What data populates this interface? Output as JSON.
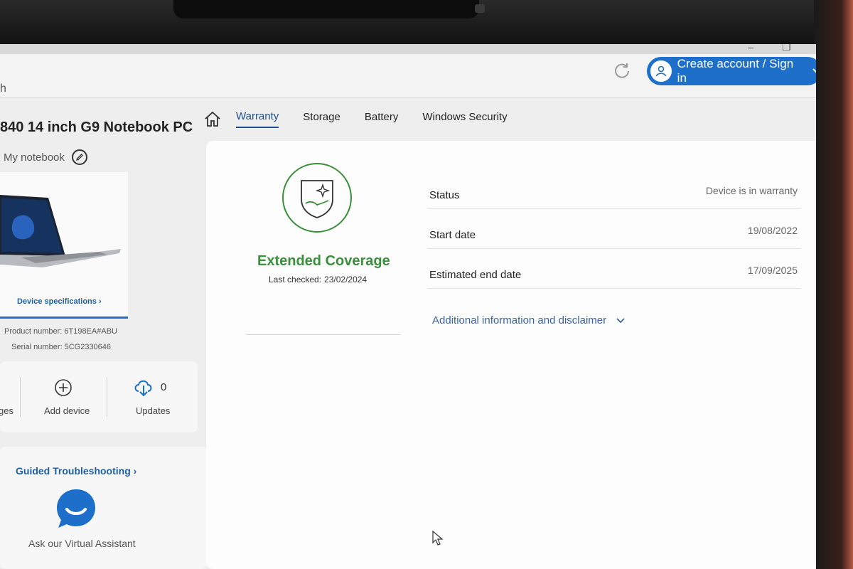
{
  "header": {
    "search_fragment": "h",
    "signin_label": "Create account / Sign in"
  },
  "device": {
    "title": "840 14 inch G9 Notebook PC",
    "nickname": "My notebook",
    "spec_link": "Device specifications ›",
    "product_number": "Product number: 6T198EA#ABU",
    "serial_number": "Serial number: 5CG2330646"
  },
  "actions": {
    "left_partial_label": "ges",
    "add_device_label": "Add device",
    "updates_label": "Updates",
    "updates_count": "0"
  },
  "help": {
    "guided_label": "Guided Troubleshooting ›",
    "assistant_label": "Ask our Virtual Assistant"
  },
  "tabs": [
    {
      "label": "Warranty",
      "active": true
    },
    {
      "label": "Storage",
      "active": false
    },
    {
      "label": "Battery",
      "active": false
    },
    {
      "label": "Windows Security",
      "active": false
    }
  ],
  "warranty": {
    "coverage_title": "Extended Coverage",
    "last_checked_label": "Last checked:",
    "last_checked_date": "23/02/2024",
    "rows": [
      {
        "label": "Status",
        "value": "Device is in warranty"
      },
      {
        "label": "Start date",
        "value": "19/08/2022"
      },
      {
        "label": "Estimated end date",
        "value": "17/09/2025"
      }
    ],
    "disclaimer_label": "Additional information and disclaimer"
  },
  "colors": {
    "accent_blue": "#1d6fc9",
    "coverage_green": "#3a8f3a"
  },
  "icons": [
    "refresh-icon",
    "user-icon",
    "chevron-down-icon",
    "edit-icon",
    "home-icon",
    "shield-icon",
    "plus-circle-icon",
    "cloud-download-icon",
    "chat-bubble-icon",
    "cursor-icon"
  ]
}
